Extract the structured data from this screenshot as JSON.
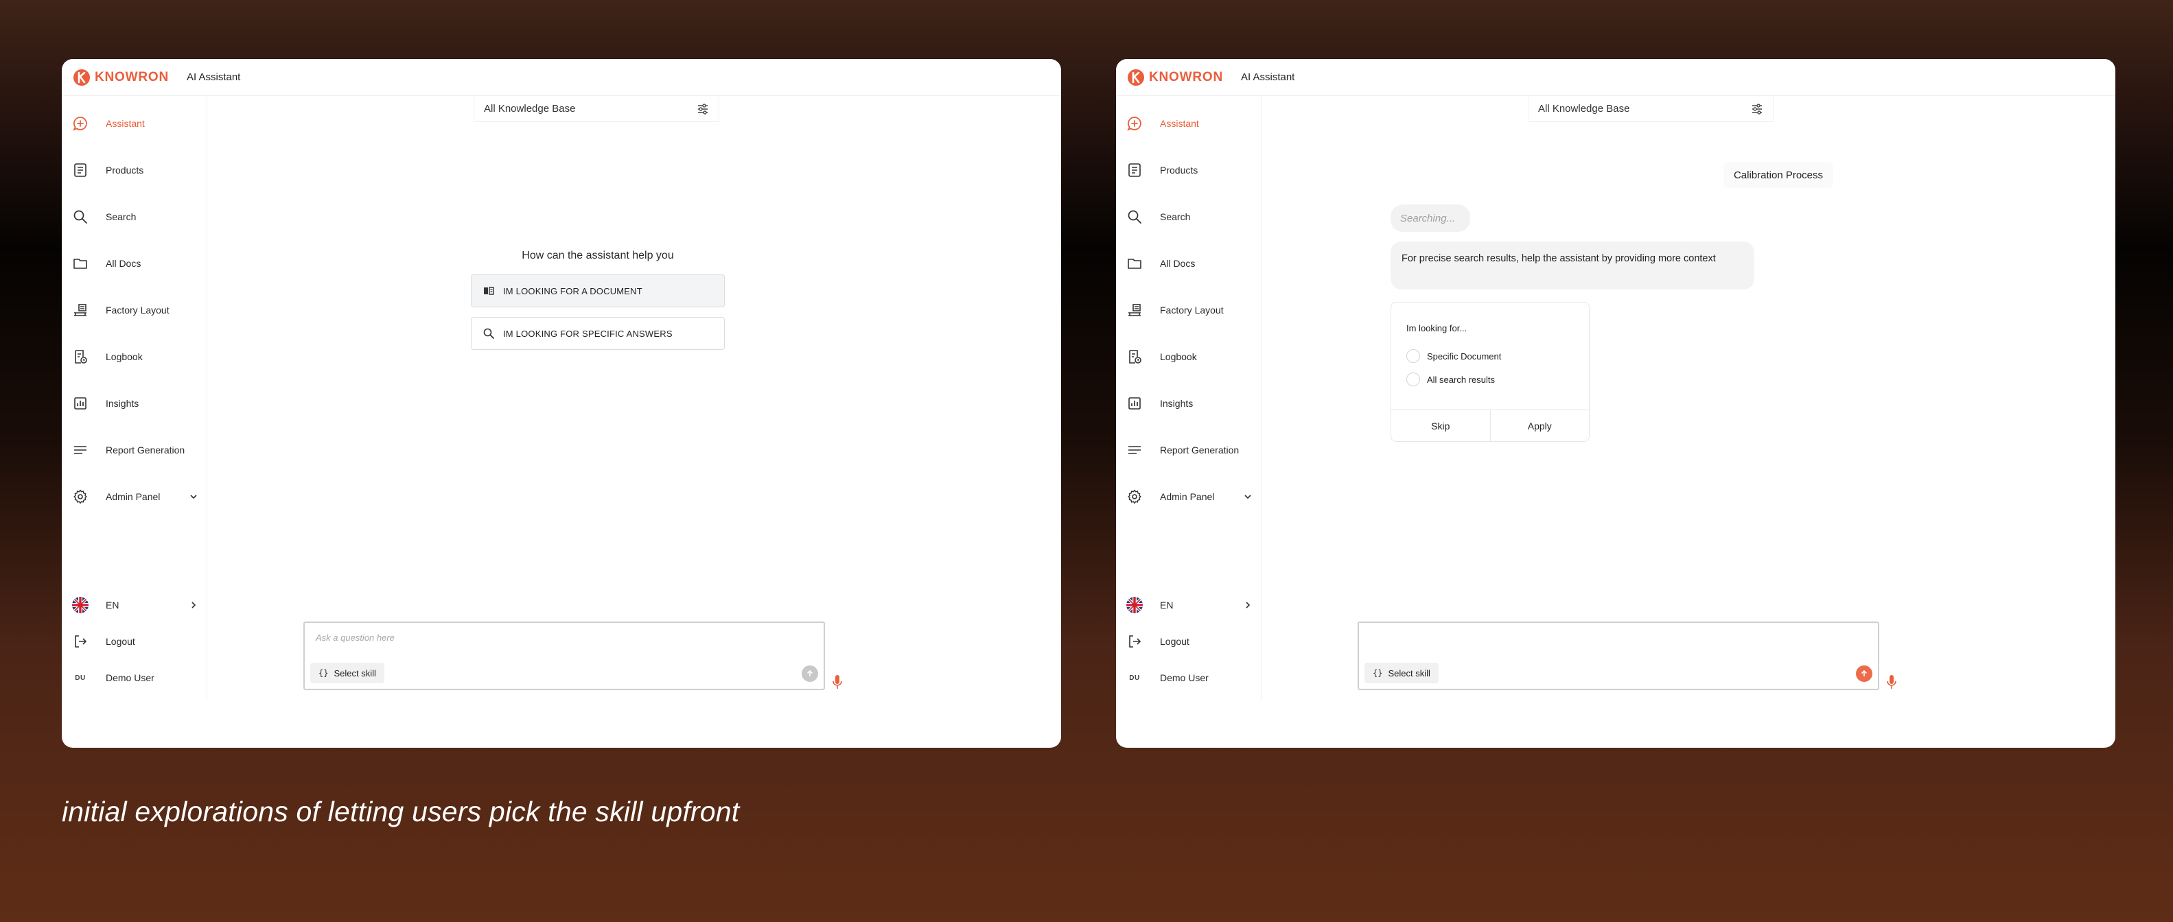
{
  "brand": {
    "name": "KNOWRON",
    "accent": "#ea5e3c"
  },
  "app_title": "AI Assistant",
  "knowledge_base": {
    "selected": "All Knowledge Base"
  },
  "sidebar": {
    "items": [
      {
        "label": "Assistant",
        "icon": "assistant-chat-icon",
        "active": true
      },
      {
        "label": "Products",
        "icon": "document-list-icon"
      },
      {
        "label": "Search",
        "icon": "search-icon"
      },
      {
        "label": "All Docs",
        "icon": "folder-icon"
      },
      {
        "label": "Factory Layout",
        "icon": "factory-layout-icon"
      },
      {
        "label": "Logbook",
        "icon": "logbook-icon"
      },
      {
        "label": "Insights",
        "icon": "bar-chart-icon"
      },
      {
        "label": "Report Generation",
        "icon": "lines-icon"
      },
      {
        "label": "Admin Panel",
        "icon": "gear-icon"
      }
    ],
    "language": "EN",
    "logout": "Logout",
    "user": {
      "initials": "DU",
      "name": "Demo User"
    }
  },
  "left_panel": {
    "prompt": "How can the assistant help you",
    "options": [
      {
        "label": "IM LOOKING FOR A DOCUMENT",
        "icon": "book-icon"
      },
      {
        "label": "IM LOOKING FOR SPECIFIC ANSWERS",
        "icon": "search-icon"
      }
    ],
    "composer": {
      "placeholder": "Ask a question here",
      "skill_label": "Select skill",
      "skill_glyph": "{}"
    }
  },
  "right_panel": {
    "chip": "Calibration Process",
    "searching": "Searching...",
    "context_message": "For precise search results, help the assistant by providing more context",
    "choice": {
      "title": "Im looking for...",
      "options": [
        "Specific Document",
        "All search results"
      ],
      "skip": "Skip",
      "apply": "Apply"
    },
    "composer": {
      "skill_label": "Select skill",
      "skill_glyph": "{}"
    }
  },
  "caption": "initial explorations of letting users pick the skill upfront"
}
